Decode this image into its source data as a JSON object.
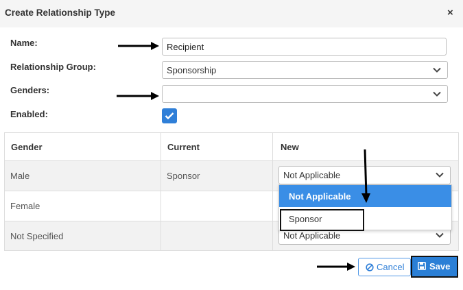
{
  "dialog": {
    "title": "Create Relationship Type",
    "close_glyph": "×"
  },
  "form": {
    "name_label": "Name:",
    "name_value": "Recipient",
    "group_label": "Relationship Group:",
    "group_value": "Sponsorship",
    "genders_label": "Genders:",
    "genders_value": "",
    "enabled_label": "Enabled:",
    "enabled_checked": true
  },
  "table": {
    "headers": [
      "Gender",
      "Current",
      "New"
    ],
    "rows": [
      {
        "gender": "Male",
        "current": "Sponsor",
        "new": "Not Applicable"
      },
      {
        "gender": "Female",
        "current": "",
        "new": ""
      },
      {
        "gender": "Not Specified",
        "current": "",
        "new": "Not Applicable"
      }
    ]
  },
  "dropdown_menu": {
    "options": [
      "Not Applicable",
      "Sponsor"
    ],
    "active_option": "Not Applicable"
  },
  "buttons": {
    "cancel_label": "Cancel",
    "save_label": "Save"
  },
  "colors": {
    "accent": "#2a7fd6",
    "menu_active": "#3a8ee6",
    "header_bg": "#f5f5f5",
    "alt_row": "#f2f2f2"
  },
  "icons": [
    "close-icon",
    "chevron-down-icon",
    "checkmark-icon",
    "ban-icon",
    "floppy-disk-icon",
    "arrow-right-icon",
    "arrow-down-icon"
  ]
}
